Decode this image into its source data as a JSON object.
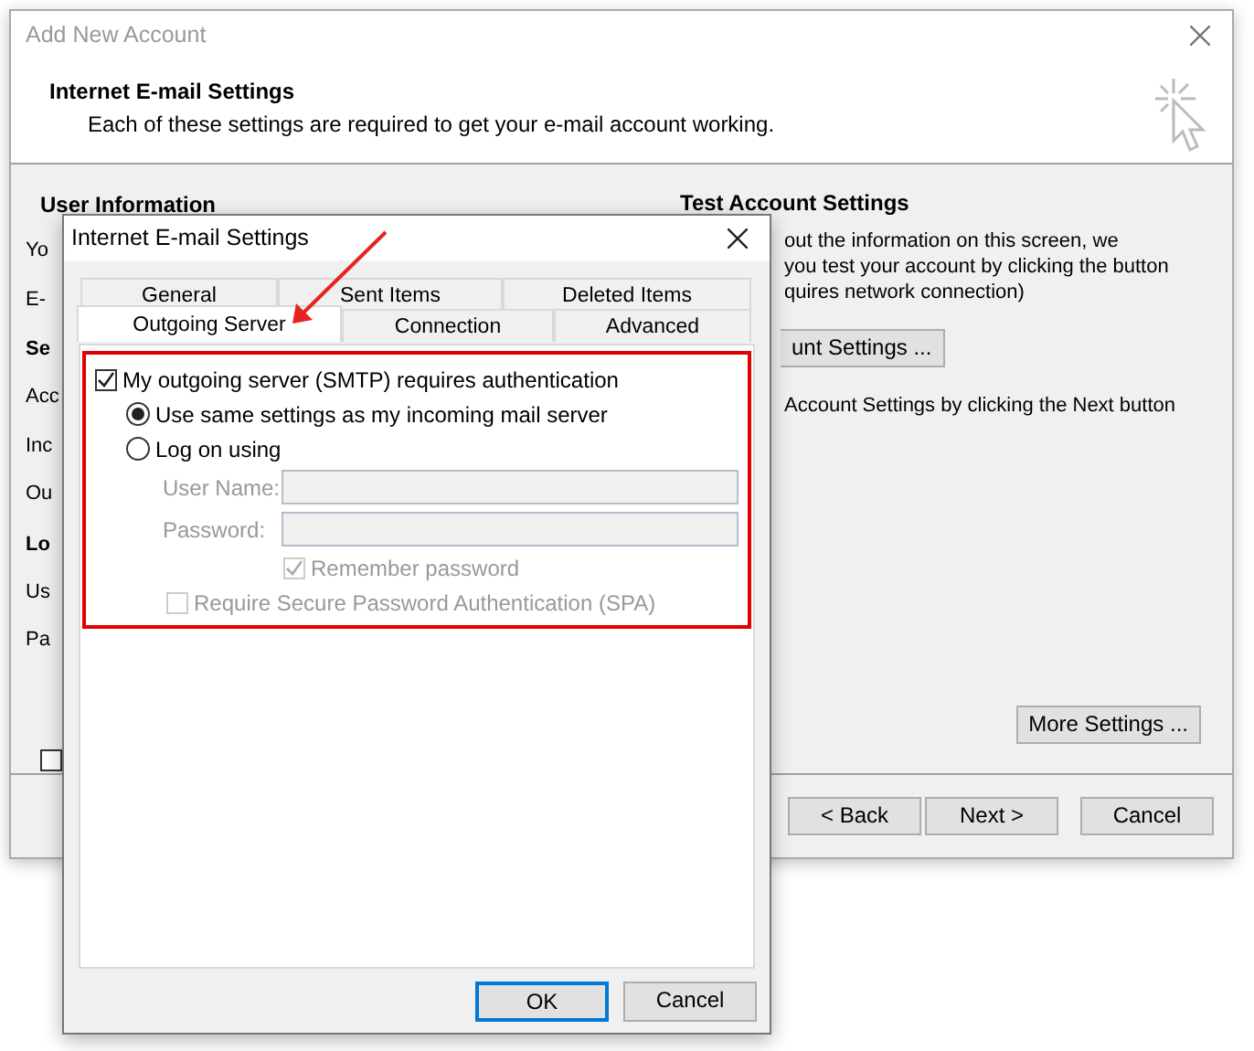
{
  "background_window": {
    "title": "Add New Account",
    "header": {
      "title": "Internet E-mail Settings",
      "subtitle": "Each of these settings are required to get your e-mail account working."
    },
    "left_column": [
      {
        "kind": "heading",
        "text": "User Information"
      },
      {
        "kind": "label",
        "text": "Yo"
      },
      {
        "kind": "label",
        "text": "E-"
      },
      {
        "kind": "heading",
        "text": "Se"
      },
      {
        "kind": "label",
        "text": "Acc"
      },
      {
        "kind": "label",
        "text": "Inc"
      },
      {
        "kind": "label",
        "text": "Ou"
      },
      {
        "kind": "heading",
        "text": "Lo"
      },
      {
        "kind": "label",
        "text": "Us"
      },
      {
        "kind": "label",
        "text": "Pa"
      }
    ],
    "left_checkbox": {
      "checked": false
    },
    "test_account": {
      "heading": "Test Account Settings",
      "lines": [
        "out the information on this screen, we",
        "you test your account by clicking the button",
        "quires network connection)"
      ],
      "test_button": "unt Settings ...",
      "note": "Account Settings by clicking the Next button"
    },
    "more_settings_button": "More Settings ...",
    "buttons": [
      "< Back",
      "Next >",
      "Cancel"
    ]
  },
  "dialog": {
    "title": "Internet E-mail Settings",
    "tabs": [
      {
        "label": "General",
        "selected": false
      },
      {
        "label": "Sent Items",
        "selected": false
      },
      {
        "label": "Deleted Items",
        "selected": false
      },
      {
        "label": "Outgoing Server",
        "selected": true
      },
      {
        "label": "Connection",
        "selected": false
      },
      {
        "label": "Advanced",
        "selected": false
      }
    ],
    "auth_checkbox": {
      "label": "My outgoing server (SMTP) requires authentication",
      "checked": true
    },
    "radios": [
      {
        "label": "Use same settings as my incoming mail server",
        "selected": true
      },
      {
        "label": "Log on using",
        "selected": false
      }
    ],
    "fields": [
      {
        "label": "User Name:",
        "disabled": true
      },
      {
        "label": "Password:",
        "disabled": true
      }
    ],
    "remember_checkbox": {
      "label": "Remember password",
      "checked": true,
      "disabled": true
    },
    "spa_checkbox": {
      "label": "Require Secure Password Authentication (SPA)",
      "checked": false,
      "disabled": true
    },
    "buttons": [
      {
        "label": "OK",
        "default": true
      },
      {
        "label": "Cancel",
        "default": false
      }
    ]
  }
}
